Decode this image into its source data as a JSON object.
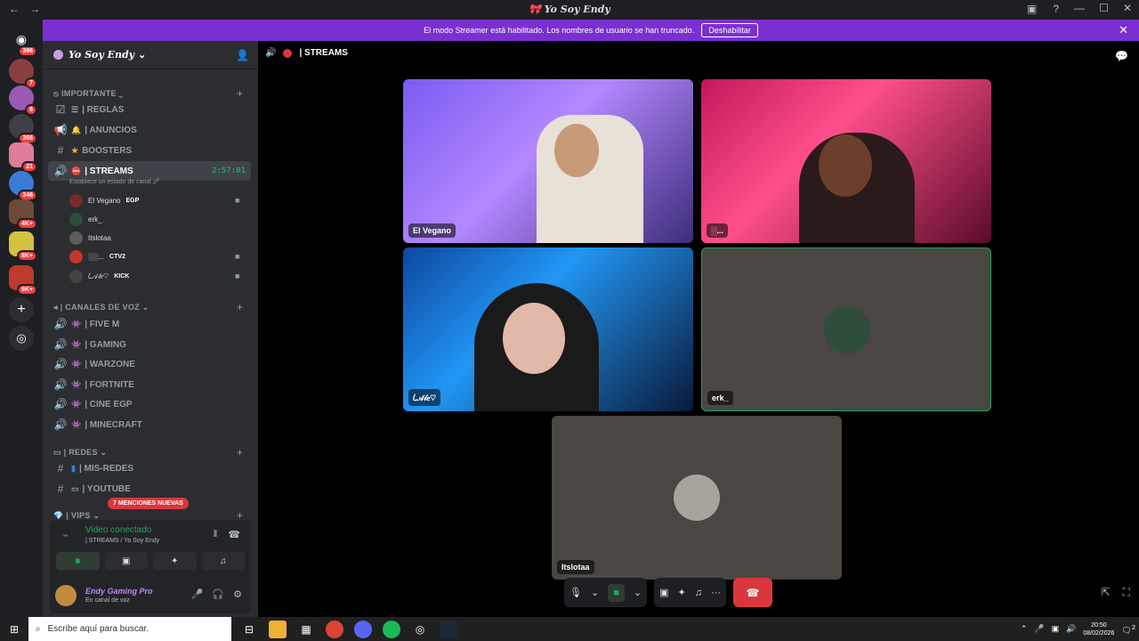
{
  "window": {
    "title": "🎀 Yo Soy Endy",
    "back": "←",
    "forward": "→",
    "minimize": "—",
    "maximize": "☐",
    "close": "✕"
  },
  "banner": {
    "text": "El modo Streamer está habilitado. Los nombres de usuario se han truncado.",
    "button": "Deshabilitar",
    "close": "✕"
  },
  "guilds": [
    {
      "badge": "396",
      "color": "#5865f2"
    },
    {
      "badge": "7",
      "color": "#8a3f3f"
    },
    {
      "badge": "6",
      "color": "#9b59b6"
    },
    {
      "badge": "366",
      "color": "#3d3f45"
    },
    {
      "badge": "21",
      "color": "#e07b9a"
    },
    {
      "badge": "346",
      "color": "#3a7bd5"
    },
    {
      "badge": "4K+",
      "color": "#6b4a3a"
    },
    {
      "badge": "8K+",
      "color": "#d4c23f"
    },
    {
      "badge": "9K+",
      "color": "#c0392b"
    }
  ],
  "guild_actions": {
    "add": "+",
    "discover": "◎"
  },
  "server": {
    "name": "Yo Soy Endy",
    "chevron": "⌄",
    "invite": "👤"
  },
  "categories": {
    "importante": "IMPORTANTE ⌄",
    "voz": "CANALES DE VOZ ⌄",
    "redes": "REDES ⌄",
    "vips": "VIPS ⌄"
  },
  "channels": {
    "reglas": "| REGLAS",
    "anuncios": "| ANUNCIOS",
    "boosters": "BOOSTERS",
    "streams": "| STREAMS",
    "streams_timer": "2:57:01",
    "streams_status": "Establece un estado de canal 🖉",
    "fivem": "| FIVE M",
    "gaming": "|  GAMING",
    "warzone": "| WARZONE",
    "fortnite": "| FORTNITE",
    "cine": "| CINE EGP",
    "minecraft": "| MINECRAFT",
    "misredes": "| MIS-REDES",
    "youtube": "| YOUTUBE"
  },
  "voice_users": [
    {
      "name": "El Vegano",
      "tag": "EGP",
      "cam": "■",
      "color": "#7a2a2a"
    },
    {
      "name": "erk_",
      "tag": "",
      "cam": "",
      "color": "#2e4d3a"
    },
    {
      "name": "Itslotaa",
      "tag": "",
      "cam": "",
      "color": "#5c5c5c"
    },
    {
      "name": "░░...",
      "tag": "CTV2",
      "cam": "■",
      "color": "#c0392b"
    },
    {
      "name": "𐑖𝒜𝓁𝑒♡",
      "tag": "KICK",
      "cam": "■",
      "color": "#444"
    }
  ],
  "mentions": "7 MENCIONES NUEVAS",
  "voice_panel": {
    "title": "Video conectado",
    "subtitle": "| STREAMS / Yo Soy Endy",
    "signal": "⌁",
    "noise": "‖",
    "disconnect": "☎"
  },
  "user_panel": {
    "name": "Endy Gaming Pro",
    "status": "En canal de voz",
    "mic": "🎤",
    "headphones": "🎧",
    "settings": "⚙"
  },
  "header": {
    "channel": "| STREAMS"
  },
  "tiles": [
    {
      "label": "El Vegano"
    },
    {
      "label": "░..."
    },
    {
      "label": "𐑖𝒜𝓁𝑒♡"
    },
    {
      "label": "erk_"
    },
    {
      "label": "Itslotaa"
    }
  ],
  "controls": {
    "mic": "🎙",
    "cam": "■",
    "screen": "▣",
    "activities": "✦",
    "soundboard": "♫",
    "more": "···",
    "hangup": "☎"
  },
  "taskbar": {
    "start": "⊞",
    "search_placeholder": "Escribe aquí para buscar.",
    "time": "20:50",
    "date": "08/02/2026",
    "notif": "2"
  },
  "colors": {
    "banner": "#7b2fd1",
    "accent_green": "#23a559",
    "danger": "#da373c"
  }
}
